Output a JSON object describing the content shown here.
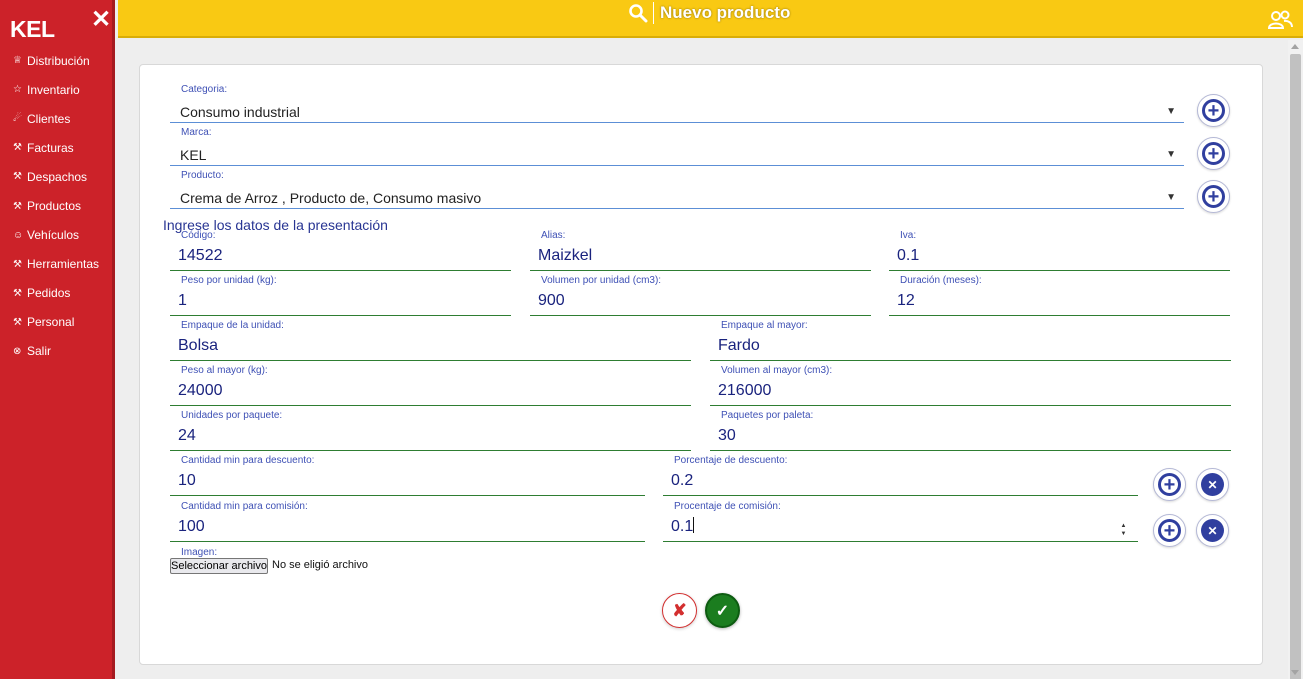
{
  "sidebar": {
    "brand": "KEL",
    "close_icon": "✕",
    "items": [
      {
        "icon": "♕",
        "label": "Distribución"
      },
      {
        "icon": "☆",
        "label": "Inventario"
      },
      {
        "icon": "☄",
        "label": "Clientes"
      },
      {
        "icon": "⚒",
        "label": "Facturas"
      },
      {
        "icon": "⚒",
        "label": "Despachos"
      },
      {
        "icon": "⚒",
        "label": "Productos"
      },
      {
        "icon": "☺",
        "label": "Vehículos"
      },
      {
        "icon": "⚒",
        "label": "Herramientas"
      },
      {
        "icon": "⚒",
        "label": "Pedidos"
      },
      {
        "icon": "⚒",
        "label": "Personal"
      },
      {
        "icon": "⊗",
        "label": "Salir"
      }
    ]
  },
  "topbar": {
    "title": "Nuevo producto",
    "left_icon": "search-icon",
    "right_icon": "users-icon"
  },
  "form": {
    "categoria": {
      "label": "Categoria:",
      "value": "Consumo industrial"
    },
    "marca": {
      "label": "Marca:",
      "value": "KEL"
    },
    "producto": {
      "label": "Producto:",
      "value": "Crema de Arroz , Producto de, Consumo masivo"
    },
    "section_title": "Ingrese los datos de la presentación",
    "codigo": {
      "label": "Código:",
      "value": "14522"
    },
    "alias": {
      "label": "Alias:",
      "value": "Maizkel"
    },
    "iva": {
      "label": "Iva:",
      "value": "0.1"
    },
    "peso_unidad": {
      "label": "Peso por unidad (kg):",
      "value": "1"
    },
    "volumen_unidad": {
      "label": "Volumen por unidad (cm3):",
      "value": "900"
    },
    "duracion": {
      "label": "Duración (meses):",
      "value": "12"
    },
    "empaque_unidad": {
      "label": "Empaque de la unidad:",
      "value": "Bolsa"
    },
    "empaque_mayor": {
      "label": "Empaque al mayor:",
      "value": "Fardo"
    },
    "peso_mayor": {
      "label": "Peso al mayor (kg):",
      "value": "24000"
    },
    "volumen_mayor": {
      "label": "Volumen al mayor (cm3):",
      "value": "216000"
    },
    "unidades_paquete": {
      "label": "Unidades por paquete:",
      "value": "24"
    },
    "paquetes_paleta": {
      "label": "Paquetes por paleta:",
      "value": "30"
    },
    "cant_descuento": {
      "label": "Cantidad min para descuento:",
      "value": "10"
    },
    "porc_descuento": {
      "label": "Porcentaje de descuento:",
      "value": "0.2"
    },
    "cant_comision": {
      "label": "Cantidad min para comisión:",
      "value": "100"
    },
    "porc_comision": {
      "label": "Procentaje de comisión:",
      "value": "0.1"
    },
    "imagen": {
      "label": "Imagen:",
      "button": "Seleccionar archivo",
      "status": "No se eligió archivo"
    }
  },
  "actions": {
    "cancel_glyph": "✘",
    "confirm_glyph": "✓"
  },
  "colors": {
    "sidebar": "#cc2229",
    "topbar": "#f9c913",
    "primary": "#303f9f",
    "underline": "#2e7d32"
  }
}
